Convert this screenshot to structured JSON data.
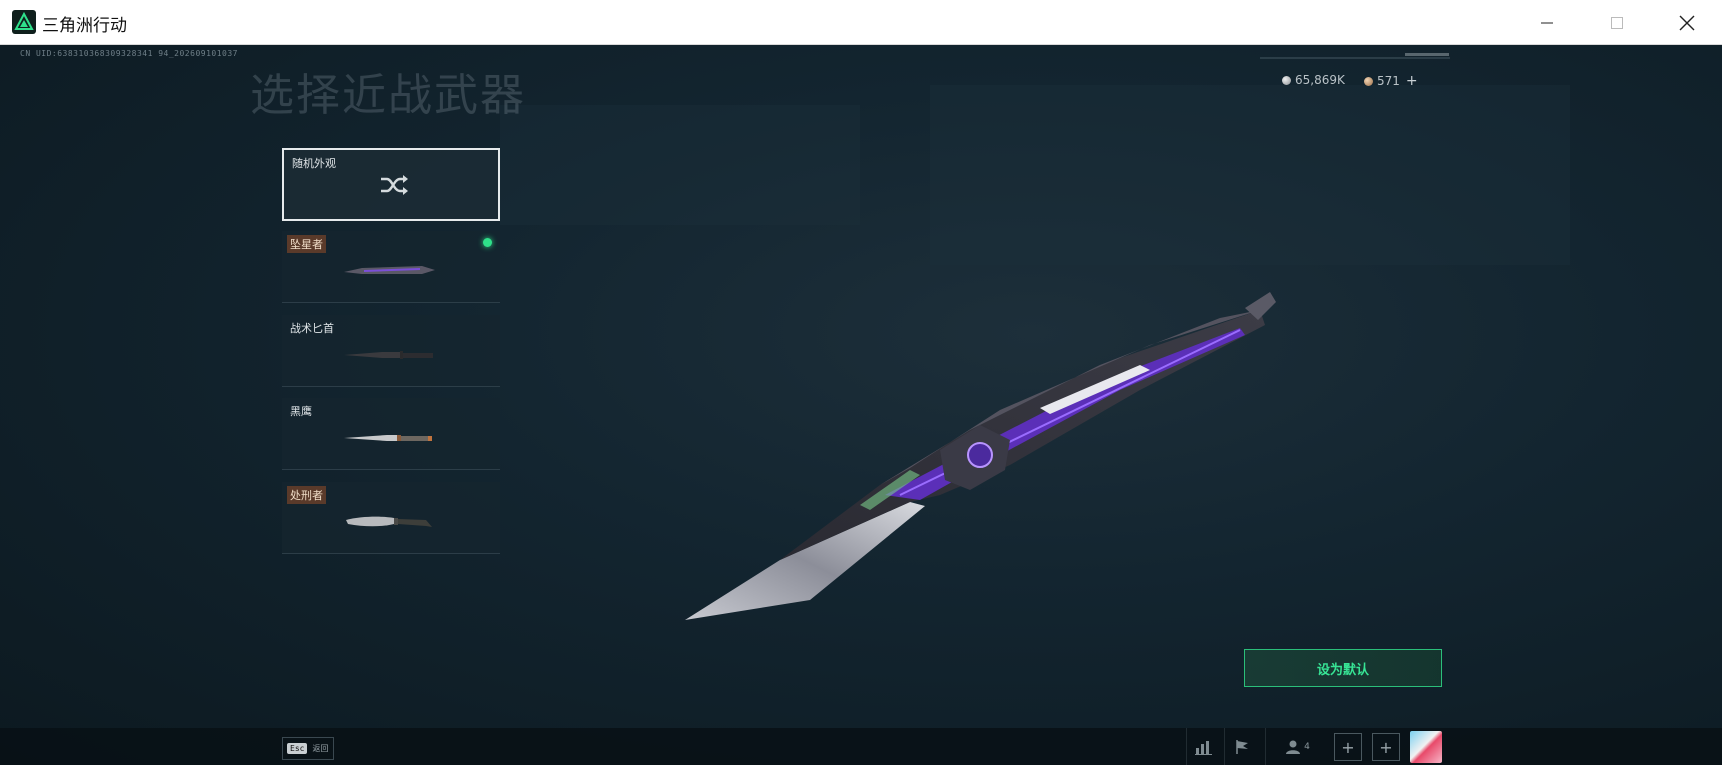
{
  "window": {
    "title": "三角洲行动"
  },
  "header": {
    "uid": "CN UID:638310368309328341 94_202609101037",
    "page_title": "选择近战武器"
  },
  "currency": {
    "silver": "65,869K",
    "bronze": "571",
    "add_label": "+"
  },
  "skins": [
    {
      "label": "随机外观",
      "icon": "shuffle-icon"
    },
    {
      "label": "坠星者",
      "tagged": true,
      "equipped": true
    },
    {
      "label": "战术匕首"
    },
    {
      "label": "黑鹰"
    },
    {
      "label": "处刑者",
      "tagged": true
    }
  ],
  "actions": {
    "set_default": "设为默认"
  },
  "bottom_bar": {
    "esc_key": "Esc",
    "esc_label": "返回",
    "squad_count": "4"
  },
  "colors": {
    "accent": "#2fe08a",
    "button_text": "#37e495"
  }
}
